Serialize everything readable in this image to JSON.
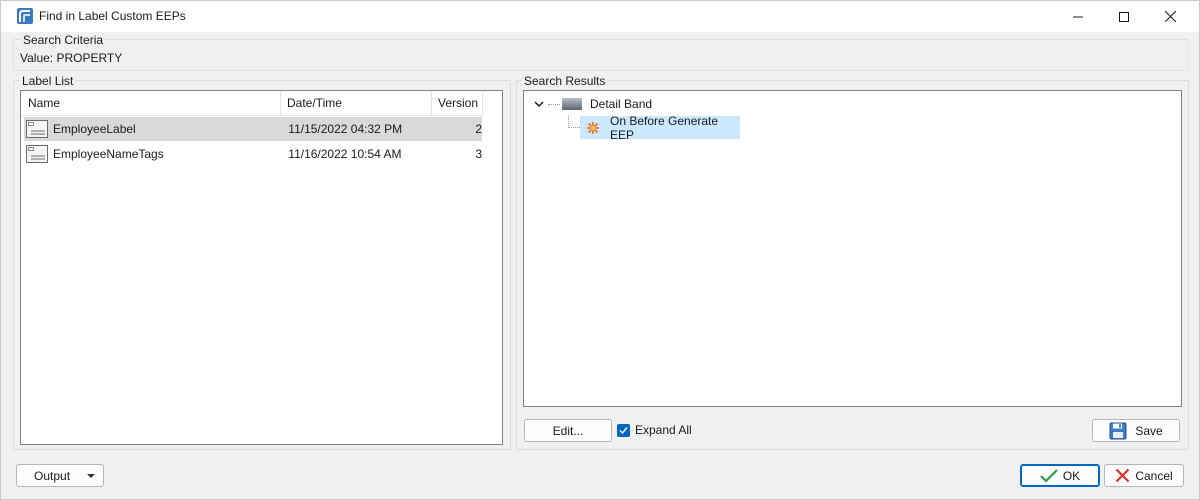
{
  "window": {
    "title": "Find in Label Custom EEPs"
  },
  "criteria": {
    "group_label": "Search Criteria",
    "value_text": "Value: PROPERTY"
  },
  "label_list": {
    "group_label": "Label List",
    "columns": [
      "Name",
      "Date/Time",
      "Version"
    ],
    "rows": [
      {
        "name": "EmployeeLabel",
        "datetime": "11/15/2022 04:32 PM",
        "version": "2"
      },
      {
        "name": "EmployeeNameTags",
        "datetime": "11/16/2022 10:54 AM",
        "version": "3"
      }
    ]
  },
  "results": {
    "group_label": "Search Results",
    "tree": {
      "band": "Detail Band",
      "event": "On Before Generate EEP"
    },
    "edit_label": "Edit...",
    "expand_all_label": "Expand All",
    "expand_all_checked": true,
    "save_label": "Save"
  },
  "footer": {
    "output_label": "Output",
    "ok_label": "OK",
    "cancel_label": "Cancel"
  },
  "colors": {
    "accent": "#0067c0",
    "selection": "#cce8ff",
    "row_selected": "#d9d9d9",
    "cancel_x": "#d9342b",
    "ok_check": "#2e9e3f"
  }
}
